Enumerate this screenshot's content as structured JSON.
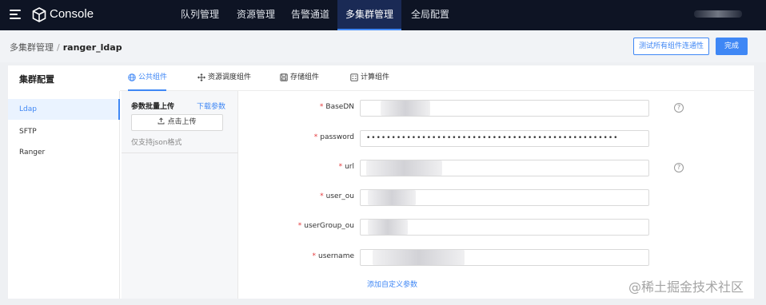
{
  "app": {
    "title": "Console"
  },
  "nav": {
    "items": [
      {
        "label": "队列管理"
      },
      {
        "label": "资源管理"
      },
      {
        "label": "告警通道"
      },
      {
        "label": "多集群管理"
      },
      {
        "label": "全局配置"
      }
    ]
  },
  "breadcrumb": {
    "parent": "多集群管理",
    "separator": "/",
    "current": "ranger_ldap"
  },
  "actions": {
    "test_label": "测试所有组件连通性",
    "done_label": "完成"
  },
  "sidebar": {
    "title": "集群配置",
    "items": [
      {
        "label": "Ldap"
      },
      {
        "label": "SFTP"
      },
      {
        "label": "Ranger"
      }
    ]
  },
  "tabs": [
    {
      "label": "公共组件",
      "icon": "globe-icon"
    },
    {
      "label": "资源调度组件",
      "icon": "move-icon"
    },
    {
      "label": "存储组件",
      "icon": "save-icon"
    },
    {
      "label": "计算组件",
      "icon": "calculator-icon"
    }
  ],
  "upload": {
    "title": "参数批量上传",
    "download_label": "下载参数",
    "button_label": "点击上传",
    "hint": "仅支持json格式"
  },
  "form": {
    "fields": [
      {
        "label": "BaseDN",
        "value": ""
      },
      {
        "label": "password",
        "value": "••••••••••••••••••••••••••••••••••••••••••••••••••"
      },
      {
        "label": "url",
        "value": ""
      },
      {
        "label": "user_ou",
        "value": ""
      },
      {
        "label": "userGroup_ou",
        "value": ""
      },
      {
        "label": "username",
        "value": ""
      }
    ],
    "add_param_label": "添加自定义参数",
    "help_symbol": "?"
  },
  "watermark": "@稀土掘金技术社区",
  "colors": {
    "accent": "#3f87f5",
    "nav_bg": "#0e1424",
    "required": "#e4393c"
  }
}
